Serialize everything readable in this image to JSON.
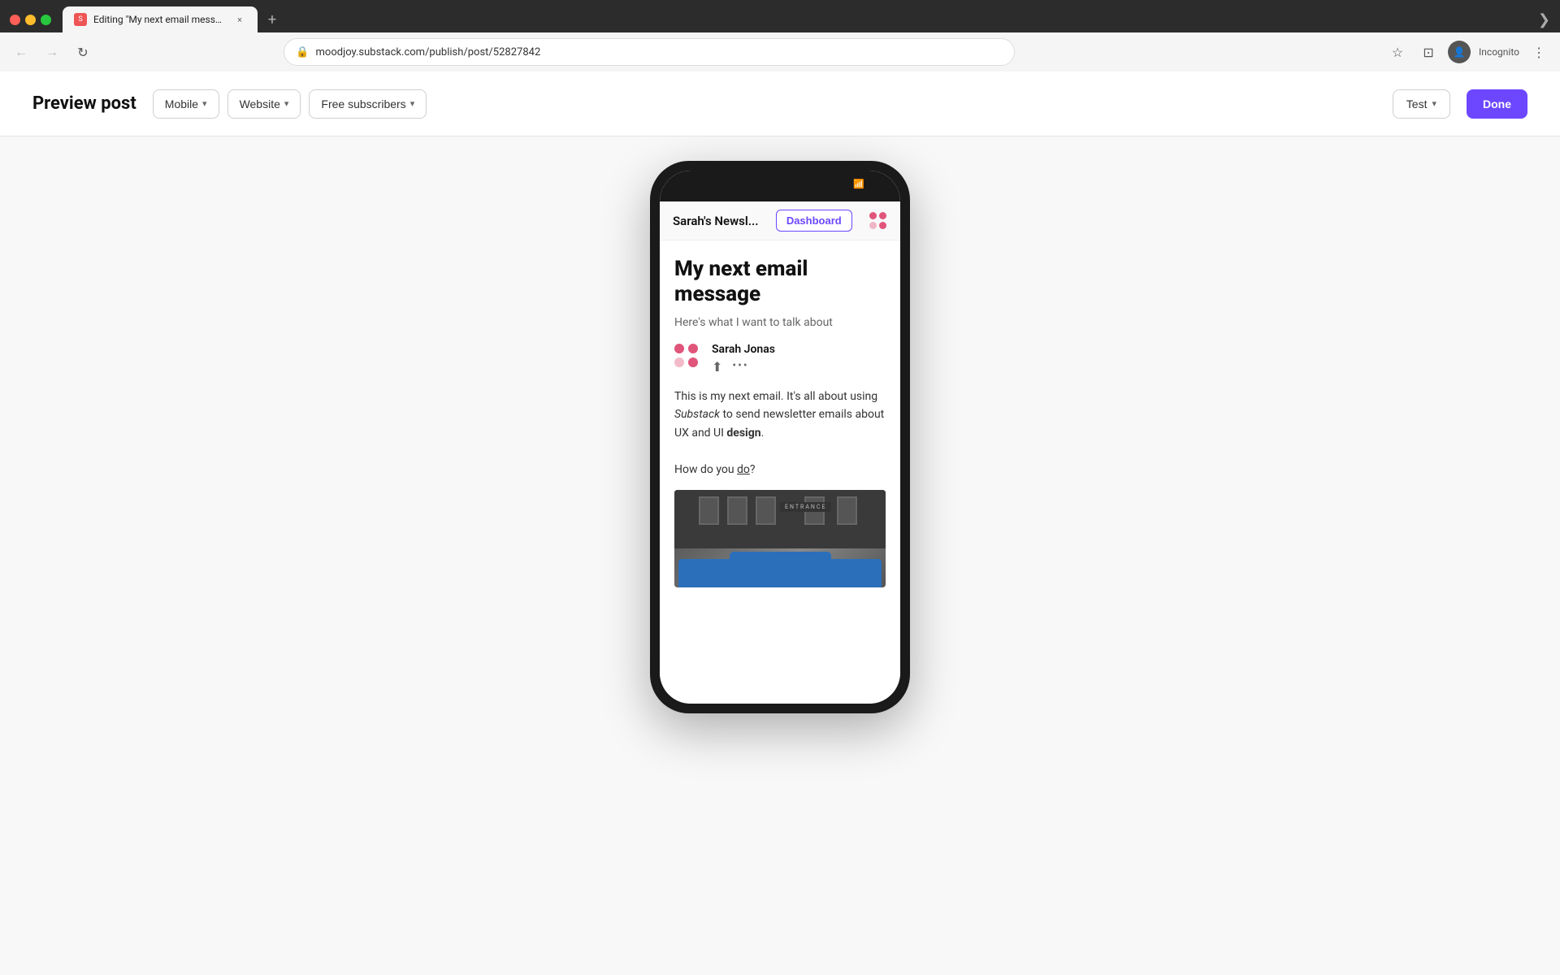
{
  "browser": {
    "tab": {
      "favicon_label": "S",
      "title": "Editing \"My next email messa...",
      "close_label": "×"
    },
    "new_tab_label": "+",
    "chevron_label": "❯",
    "address": "moodjoy.substack.com/publish/post/52827842",
    "back_label": "←",
    "forward_label": "→",
    "reload_label": "↻",
    "bookmark_label": "☆",
    "extensions_label": "⊡",
    "profile_label": "👤",
    "incognito_label": "Incognito",
    "menu_label": "⋮"
  },
  "page": {
    "title": "Preview post",
    "controls": {
      "mobile_label": "Mobile",
      "website_label": "Website",
      "subscribers_label": "Free subscribers",
      "test_label": "Test",
      "done_label": "Done",
      "chevron_label": "▾"
    }
  },
  "phone": {
    "nav": {
      "newsletter_name": "Sarah's Newsl...",
      "dashboard_btn": "Dashboard"
    },
    "article": {
      "title": "My next email message",
      "subtitle": "Here's what I want to talk about",
      "author": "Sarah Jonas",
      "body_line1": "This is my next email. It's all about",
      "body_line2": "using ",
      "body_italic": "Substack",
      "body_line3": " to send newsletter",
      "body_line4": "emails about UX and UI ",
      "body_bold": "design",
      "body_end": ".",
      "body_question": "How do you ",
      "body_underline": "do",
      "body_question_end": "?",
      "entrance_label": "ENTRANCE"
    }
  }
}
